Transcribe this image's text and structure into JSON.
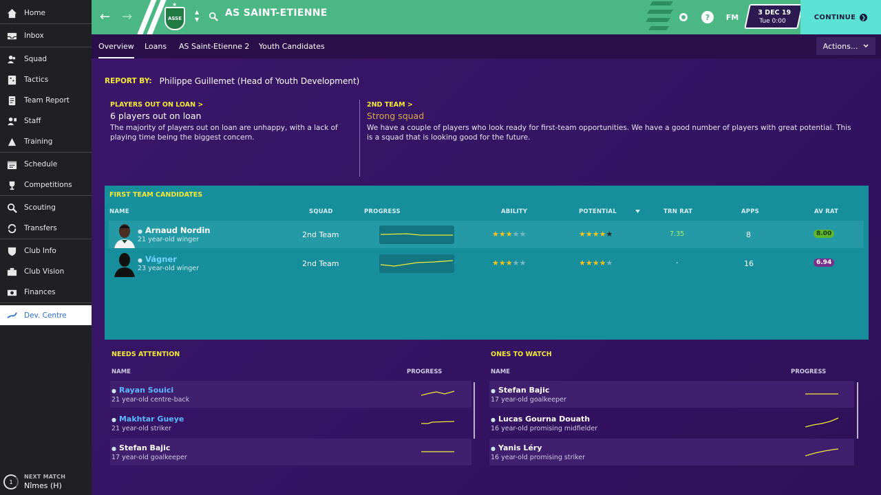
{
  "sidebar": {
    "items": [
      {
        "label": "Home",
        "icon": "home-icon"
      },
      {
        "label": "Inbox",
        "icon": "inbox-icon"
      },
      {
        "label": "Squad",
        "icon": "squad-icon"
      },
      {
        "label": "Tactics",
        "icon": "tactics-icon"
      },
      {
        "label": "Team Report",
        "icon": "report-icon"
      },
      {
        "label": "Staff",
        "icon": "staff-icon"
      },
      {
        "label": "Training",
        "icon": "training-icon"
      },
      {
        "label": "Schedule",
        "icon": "calendar-icon"
      },
      {
        "label": "Competitions",
        "icon": "trophy-icon"
      },
      {
        "label": "Scouting",
        "icon": "search-icon"
      },
      {
        "label": "Transfers",
        "icon": "transfer-icon"
      },
      {
        "label": "Club Info",
        "icon": "shield-icon"
      },
      {
        "label": "Club Vision",
        "icon": "vision-icon"
      },
      {
        "label": "Finances",
        "icon": "money-icon"
      },
      {
        "label": "Dev. Centre",
        "icon": "development-icon"
      }
    ],
    "next_match": {
      "label": "NEXT MATCH",
      "value": "Nîmes (H)",
      "days": "1"
    }
  },
  "header": {
    "club_name": "AS SAINT-ETIENNE",
    "crest_text": "ASSE",
    "date": "3 DEC 19",
    "time": "Tue 0:00",
    "fm_label": "FM",
    "continue_label": "CONTINUE",
    "accent": "#4bb784"
  },
  "tabs": {
    "items": [
      "Overview",
      "Loans",
      "AS Saint-Etienne 2",
      "Youth Candidates"
    ],
    "actions_label": "Actions..."
  },
  "report": {
    "label": "REPORT BY:",
    "author": "Philippe Guillemet (Head of Youth Development)"
  },
  "loans": {
    "heading": "PLAYERS OUT ON LOAN >",
    "title": "6 players out on loan",
    "body": "The majority of players out on loan are unhappy, with a lack of playing time being the biggest concern."
  },
  "second_team": {
    "heading": "2ND TEAM >",
    "title": "Strong squad",
    "body": "We have a couple of players who look ready for first-team opportunities. We have a good number of players with great potential. This is a squad that is looking good for the future."
  },
  "first_team": {
    "title": "FIRST TEAM CANDIDATES",
    "columns": {
      "name": "NAME",
      "squad": "SQUAD",
      "progress": "PROGRESS",
      "ability": "ABILITY",
      "potential": "POTENTIAL",
      "trn": "TRN RAT",
      "apps": "APPS",
      "avrat": "AV RAT"
    },
    "rows": [
      {
        "name": "Arnaud Nordin",
        "sub": "21 year-old winger",
        "squad": "2nd Team",
        "ability": 3,
        "potential": 3.5,
        "trn": "7.35",
        "apps": "8",
        "avrat": "8.00"
      },
      {
        "name": "Vágner",
        "sub": "23 year-old winger",
        "squad": "2nd Team",
        "ability": 3,
        "potential": 4,
        "trn": "-",
        "apps": "16",
        "avrat": "6.94"
      }
    ]
  },
  "needs_attention": {
    "title": "NEEDS ATTENTION",
    "col_name": "NAME",
    "col_progress": "PROGRESS",
    "rows": [
      {
        "name": "Rayan Souici",
        "sub": "21 year-old centre-back"
      },
      {
        "name": "Makhtar Gueye",
        "sub": "21 year-old striker"
      },
      {
        "name": "Stefan Bajic",
        "sub": "17 year-old goalkeeper"
      }
    ]
  },
  "ones_to_watch": {
    "title": "ONES TO WATCH",
    "col_name": "NAME",
    "col_progress": "PROGRESS",
    "rows": [
      {
        "name": "Stefan Bajic",
        "sub": "17 year-old goalkeeper"
      },
      {
        "name": "Lucas Gourna Douath",
        "sub": "16 year-old promising midfielder"
      },
      {
        "name": "Yanis Léry",
        "sub": "16 year-old promising striker"
      }
    ]
  }
}
